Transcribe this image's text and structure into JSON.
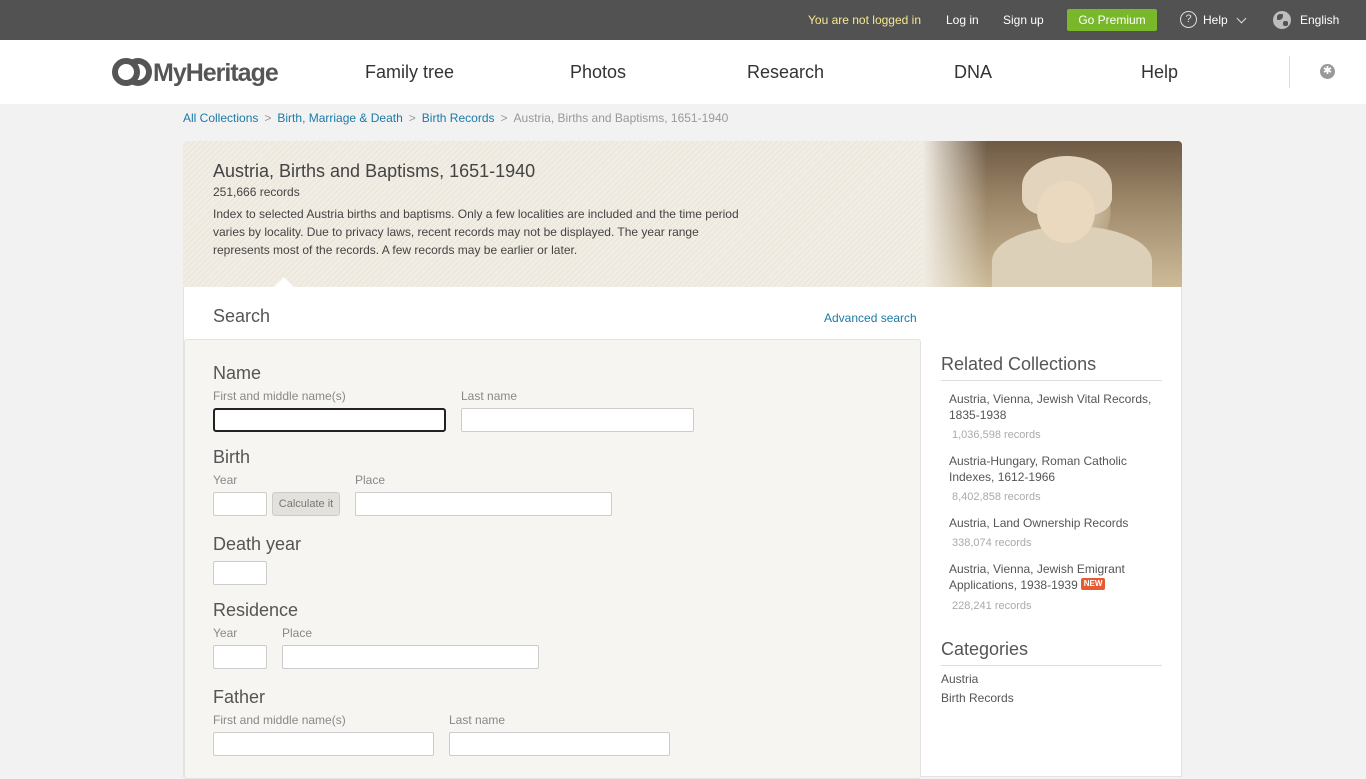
{
  "topbar": {
    "not_logged": "You are not logged in",
    "login": "Log in",
    "signup": "Sign up",
    "premium": "Go Premium",
    "help": "Help",
    "language": "English",
    "accent_color": "#78b82a"
  },
  "header": {
    "logo": "MyHeritage",
    "nav": [
      "Family tree",
      "Photos",
      "Research",
      "DNA",
      "Help"
    ]
  },
  "breadcrumb": [
    "All Collections",
    "Birth, Marriage & Death",
    "Birth Records",
    "Austria, Births and Baptisms, 1651-1940"
  ],
  "collection": {
    "title": "Austria, Births and Baptisms, 1651-1940",
    "count": "251,666 records",
    "description": "Index to selected Austria births and baptisms. Only a few localities are included and the time period varies by locality. Due to privacy laws, recent records may not be displayed. The year range represents most of the records. A few records may be earlier or later."
  },
  "search": {
    "heading": "Search",
    "advanced": "Advanced search",
    "name": {
      "heading": "Name",
      "first_label": "First and middle name(s)",
      "last_label": "Last name"
    },
    "birth": {
      "heading": "Birth",
      "year_label": "Year",
      "calc_button": "Calculate it",
      "place_label": "Place"
    },
    "death": {
      "heading": "Death year"
    },
    "residence": {
      "heading": "Residence",
      "year_label": "Year",
      "place_label": "Place"
    },
    "father": {
      "heading": "Father",
      "first_label": "First and middle name(s)",
      "last_label": "Last name"
    }
  },
  "related": {
    "heading": "Related Collections",
    "items": [
      {
        "title": "Austria, Vienna, Jewish Vital Records, 1835-1938",
        "count": "1,036,598 records"
      },
      {
        "title": "Austria-Hungary, Roman Catholic Indexes, 1612-1966",
        "count": "8,402,858 records"
      },
      {
        "title": "Austria, Land Ownership Records",
        "count": "338,074 records"
      },
      {
        "title": "Austria, Vienna, Jewish Emigrant Applications, 1938-1939",
        "count": "228,241 records",
        "badge": "NEW"
      }
    ]
  },
  "categories": {
    "heading": "Categories",
    "items": [
      "Austria",
      "Birth Records"
    ]
  }
}
